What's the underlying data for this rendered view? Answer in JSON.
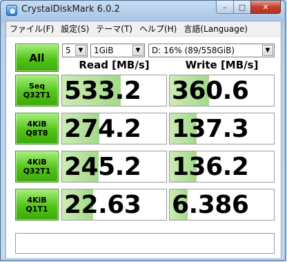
{
  "window": {
    "title": "CrystalDiskMark 6.0.2"
  },
  "titlebar_buttons": {
    "minimize": "–",
    "maximize": "□",
    "close": "✕"
  },
  "menu": [
    "ファイル(F)",
    "設定(S)",
    "テーマ(T)",
    "ヘルプ(H)",
    "言語(Language)"
  ],
  "controls": {
    "all_label": "All",
    "count": "5",
    "size": "1GiB",
    "drive": "D: 16% (89/558GiB)"
  },
  "headers": {
    "read": "Read [MB/s]",
    "write": "Write [MB/s]"
  },
  "rows": [
    {
      "line1": "Seq",
      "line2": "Q32T1",
      "read": "533.2",
      "write": "360.6",
      "read_fill": 0.56,
      "write_fill": 0.38
    },
    {
      "line1": "4KiB",
      "line2": "Q8T8",
      "read": "274.2",
      "write": "137.3",
      "read_fill": 0.36,
      "write_fill": 0.26
    },
    {
      "line1": "4KiB",
      "line2": "Q32T1",
      "read": "245.2",
      "write": "136.2",
      "read_fill": 0.35,
      "write_fill": 0.26
    },
    {
      "line1": "4KiB",
      "line2": "Q1T1",
      "read": "22.63",
      "write": "6.386",
      "read_fill": 0.3,
      "write_fill": 0.17
    }
  ],
  "comment": ""
}
